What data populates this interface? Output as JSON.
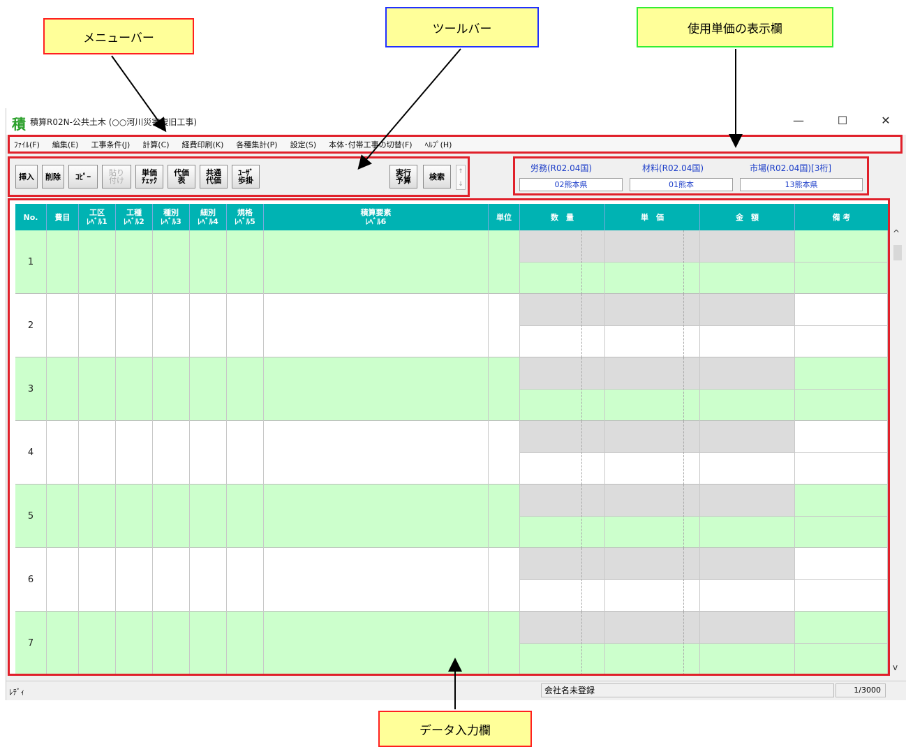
{
  "callouts": {
    "menubar": "メニューバー",
    "toolbar": "ツールバー",
    "price_display": "使用単価の表示欄",
    "data_entry": "データ入力欄"
  },
  "window": {
    "icon": "積",
    "title": "積算R02N-公共土木 (○○河川災害復旧工事)",
    "minimize": "—",
    "maximize": "☐",
    "close": "✕"
  },
  "menu": [
    "ﾌｧｲﾙ(F)",
    "編集(E)",
    "工事条件(J)",
    "計算(C)",
    "経費印刷(K)",
    "各種集計(P)",
    "設定(S)",
    "本体･付帯工事の切替(F)",
    "ﾍﾙﾌﾟ(H)"
  ],
  "toolbar": {
    "insert": "挿入",
    "delete": "削除",
    "copy": "ｺﾋﾟｰ",
    "paste": "貼り\n付け",
    "unit_check": "単価\nﾁｪｯｸ",
    "proxy_table": "代価\n表",
    "common_proxy": "共通\n代価",
    "user_rate": "ﾕｰｻﾞ\n歩掛",
    "exec_budget": "実行\n予算",
    "search": "検索",
    "scroll_up": "↑",
    "scroll_down": "↓"
  },
  "prices": {
    "labor_label": "労務(R02.04国)",
    "labor_value": "02熊本県",
    "material_label": "材料(R02.04国)",
    "material_value": "01熊本",
    "market_label": "市場(R02.04国)[3桁]",
    "market_value": "13熊本県"
  },
  "grid": {
    "headers": {
      "no": "No.",
      "cost": "費目",
      "kouku": "工区\nﾚﾍﾞﾙ1",
      "koushu": "工種\nﾚﾍﾞﾙ2",
      "shubetsu": "種別\nﾚﾍﾞﾙ3",
      "saibetsu": "細別\nﾚﾍﾞﾙ4",
      "kikaku": "規格\nﾚﾍﾞﾙ5",
      "element": "積算要素\nﾚﾍﾞﾙ6",
      "unit": "単位",
      "qty": "数　量",
      "price": "単　価",
      "amount": "金　額",
      "note": "備 考"
    },
    "rows": [
      "1",
      "2",
      "3",
      "4",
      "5",
      "6",
      "7"
    ]
  },
  "scrollbar": {
    "up": "^",
    "down": "v"
  },
  "status": {
    "ready": "ﾚﾃﾞｨ",
    "company": "会社名未登録",
    "count": "1/3000"
  }
}
